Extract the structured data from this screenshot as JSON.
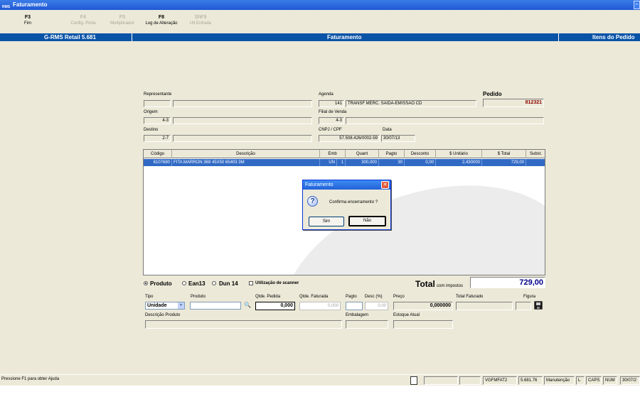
{
  "window": {
    "title": "Faturamento",
    "logo": "RMS"
  },
  "toolbar": [
    {
      "key": "F3",
      "label": "Fim",
      "enabled": true
    },
    {
      "key": "F4",
      "label": "Config. Porta",
      "enabled": false
    },
    {
      "key": "F5",
      "label": "Multiplicador",
      "enabled": false
    },
    {
      "key": "F8",
      "label": "Log de Alteração",
      "enabled": true
    },
    {
      "key": "ShF9",
      "label": "Ult.Entrada",
      "enabled": false
    }
  ],
  "header_bar": {
    "app": "G-RMS Retail 5.681",
    "module": "Faturamento",
    "right": "Itens do Pedido"
  },
  "form": {
    "representante": {
      "label": "Representante",
      "code": "",
      "name": ""
    },
    "agenda": {
      "label": "Agenda",
      "code": "141",
      "desc": "TRANSF MERC. SAIDA-EMISSAO CD"
    },
    "pedido": {
      "label": "Pedido",
      "value": "812321"
    },
    "origem": {
      "label": "Origem",
      "code": "4-3",
      "name": ""
    },
    "filial": {
      "label": "Filial de Venda",
      "code": "4-3",
      "name": ""
    },
    "destino": {
      "label": "Destino",
      "code": "2-7",
      "name": ""
    },
    "cnpj": {
      "label": "CNPJ / CPF",
      "value": "57.508.426/0002-59"
    },
    "data": {
      "label": "Data",
      "value": "30/07/13"
    }
  },
  "grid": {
    "columns": [
      "Código",
      "Descrição",
      "Emb",
      "Quant",
      "Pagto",
      "Desconto",
      "$ Unitário",
      "$ Total",
      "Subst."
    ],
    "rows": [
      {
        "codigo": "6107680",
        "descricao": "FITA MARRON 369 45X50 65403 3M",
        "emb": "UN",
        "emb_qty": "1",
        "quant": "300,000",
        "pagto": "30",
        "desconto": "0,00",
        "unitario": "2,430000",
        "total": "729,00",
        "subst": ""
      }
    ]
  },
  "dialog": {
    "title": "Faturamento",
    "message": "Confirma encerramento ?",
    "yes": "Sim",
    "no": "Não",
    "icon": "question-icon"
  },
  "options": {
    "radios": [
      {
        "label": "Produto",
        "checked": true
      },
      {
        "label": "Ean13",
        "checked": false
      },
      {
        "label": "Dun 14",
        "checked": false
      }
    ],
    "scanner": {
      "label": "Utilização de scanner",
      "checked": false
    }
  },
  "total": {
    "label": "Total",
    "sublabel": "com impostos",
    "value": "729,00"
  },
  "entry": {
    "tipo_label": "Tipo",
    "tipo_value": "Unidade",
    "produto_label": "Produto",
    "produto_value": "",
    "qtde_pedida_label": "Qtde. Pedida",
    "qtde_pedida_value": "0,000",
    "qtde_faturada_label": "Qtde. Faturada",
    "qtde_faturada_value": "0,000",
    "pagto_label": "Pagto",
    "pagto_value": "",
    "desc_label": "Desc (%)",
    "desc_value": "0,00",
    "preco_label": "Preço",
    "preco_value": "0,000000",
    "total_faturado_label": "Total Faturado",
    "total_faturado_value": "",
    "figura_label": "Figura",
    "descricao_label": "Descrição Produto",
    "descricao_value": "",
    "embalagem_label": "Embalagem",
    "embalagem_value": "",
    "estoque_label": "Estoque Atual",
    "estoque_value": ""
  },
  "statusbar": {
    "help": "Pressione F1 para obter Ajuda",
    "program": "VGFMFAT2",
    "version": "5.681.76",
    "mode": "Manutenção",
    "l": "L",
    "caps": "CAPS",
    "num": "NUM",
    "date": "30/07/2"
  }
}
